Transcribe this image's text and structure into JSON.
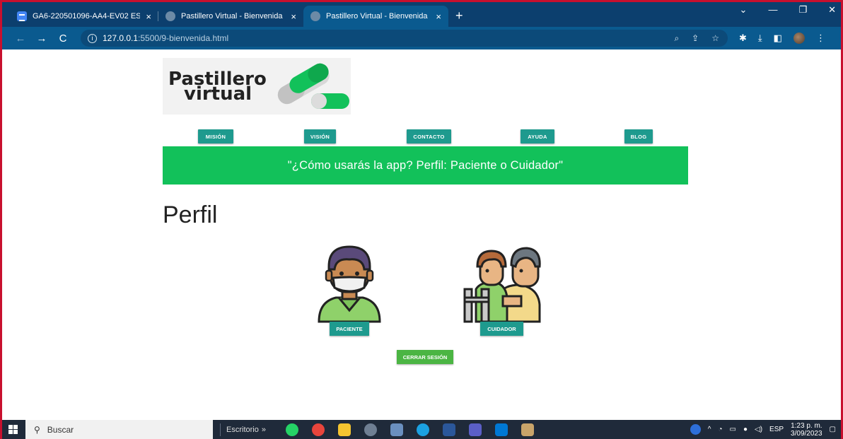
{
  "browser": {
    "tabs": [
      {
        "title": "GA6-220501096-AA4-EV02 ESTA",
        "close": "×"
      },
      {
        "title": "Pastillero Virtual - Bienvenida",
        "close": "×"
      },
      {
        "title": "Pastillero Virtual - Bienvenida",
        "close": "×"
      }
    ],
    "new_tab": "+",
    "url_host": "127.0.0.1",
    "url_path": ":5500/9-bienvenida.html"
  },
  "page": {
    "logo": {
      "line1": "Pastillero",
      "line2": "virtual"
    },
    "nav": [
      "MISIÓN",
      "VISIÓN",
      "CONTACTO",
      "AYUDA",
      "BLOG"
    ],
    "banner": "\"¿Cómo usarás la app? Perfil: Paciente o Cuidador\"",
    "heading": "Perfil",
    "profiles": {
      "patient": "PACIENTE",
      "caregiver": "CUIDADOR"
    },
    "logout": "CERRAR SESIÓN"
  },
  "taskbar": {
    "search_placeholder": "Buscar",
    "desktop": "Escritorio",
    "chevron": "»",
    "lang": "ESP",
    "time": "1:23 p. m.",
    "date": "3/09/2023"
  },
  "colors": {
    "accent_teal": "#1e9a8e",
    "banner_green": "#12c15a",
    "logout_green": "#4bb543",
    "browser_blue": "#0a5a8f"
  }
}
